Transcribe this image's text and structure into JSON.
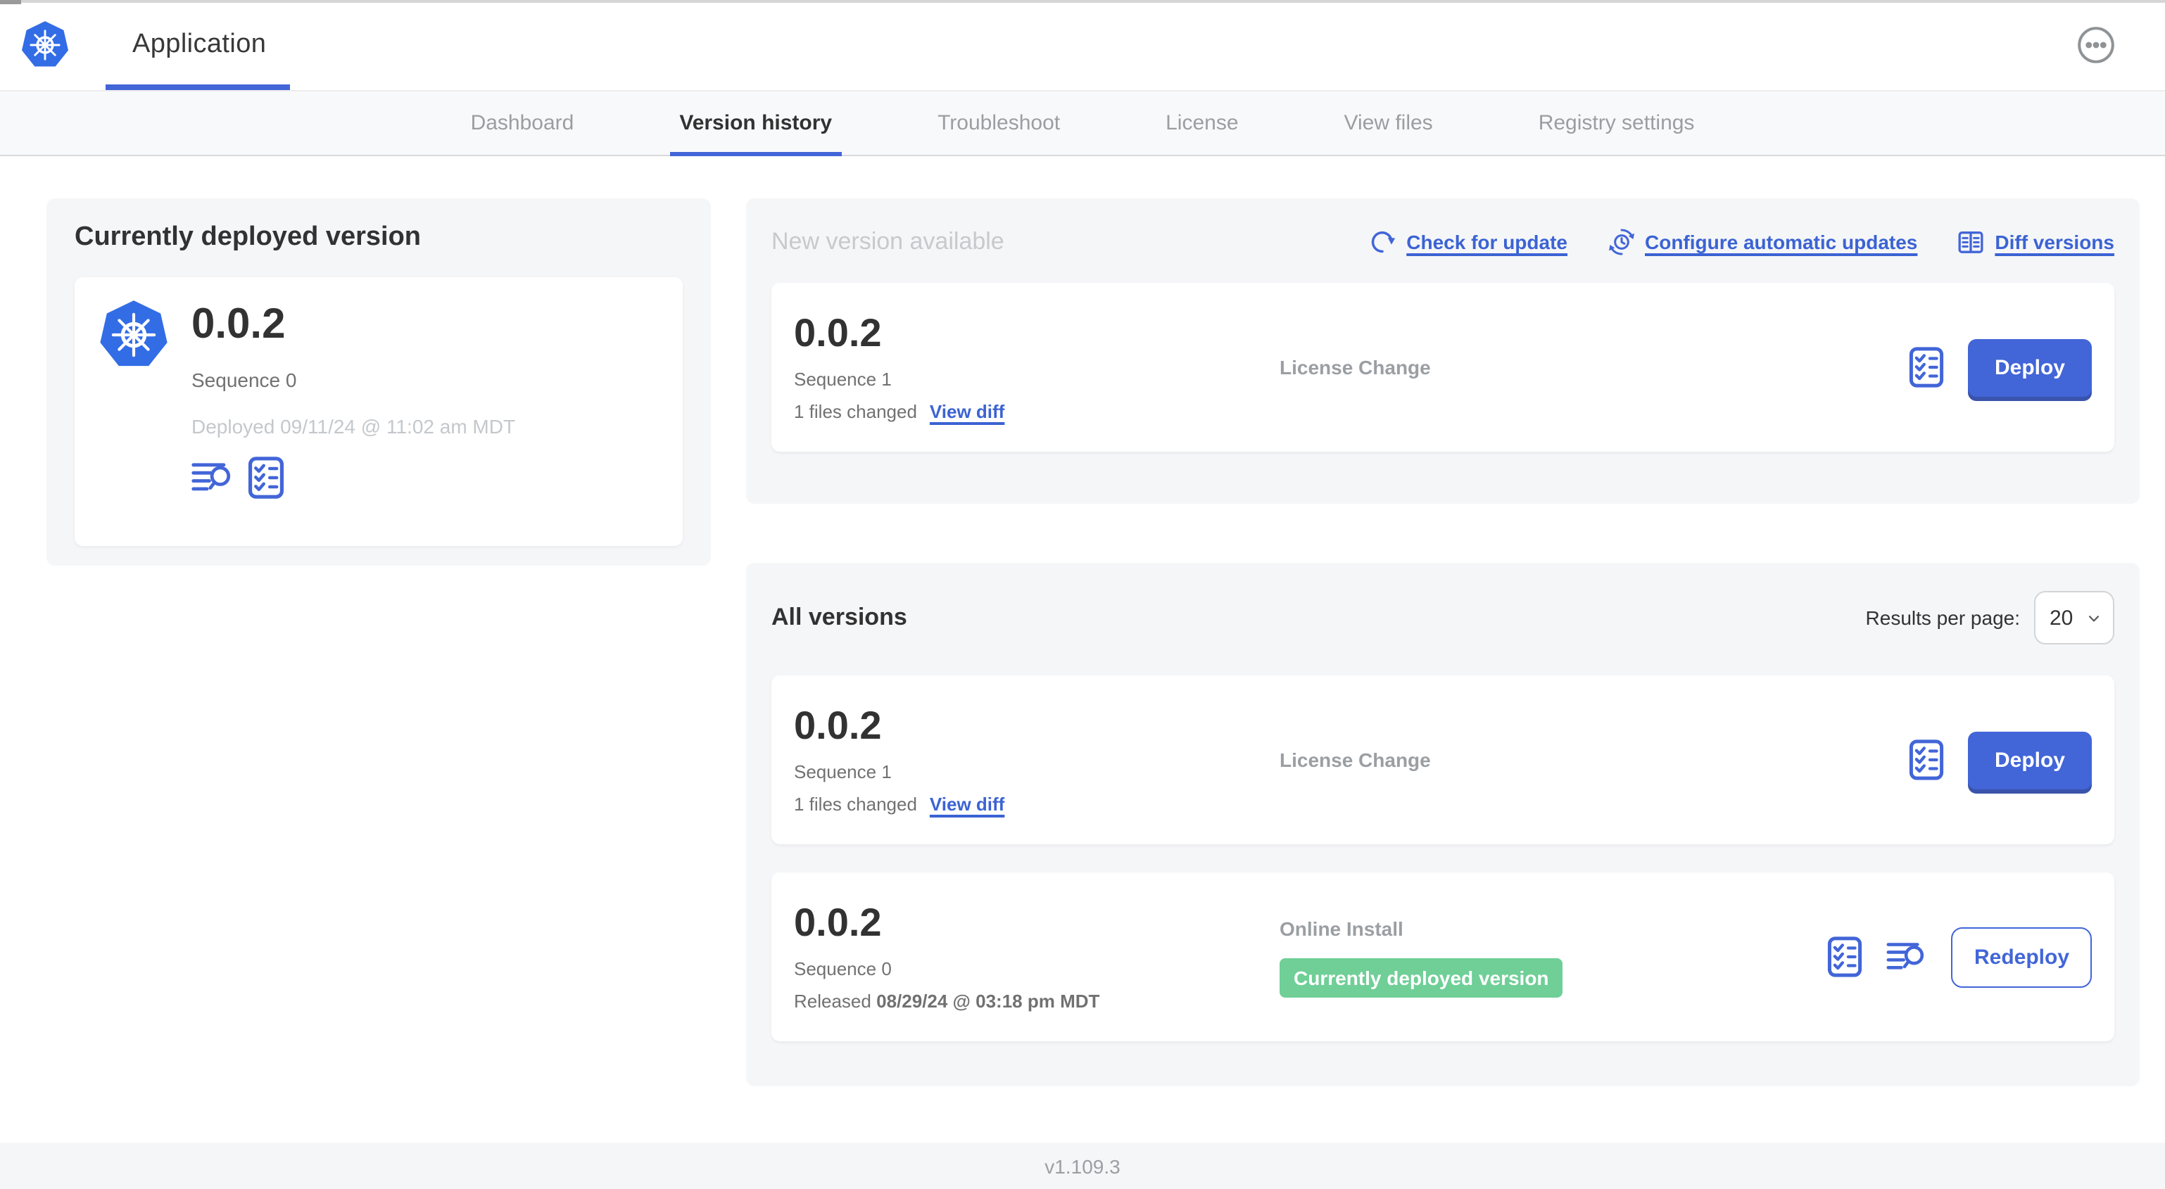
{
  "header": {
    "app_title": "Application"
  },
  "nav": {
    "tabs": [
      {
        "label": "Dashboard",
        "active": false
      },
      {
        "label": "Version history",
        "active": true
      },
      {
        "label": "Troubleshoot",
        "active": false
      },
      {
        "label": "License",
        "active": false
      },
      {
        "label": "View files",
        "active": false
      },
      {
        "label": "Registry settings",
        "active": false
      }
    ]
  },
  "current_version_card": {
    "title": "Currently deployed version",
    "version": "0.0.2",
    "sequence": "Sequence 0",
    "deployed": "Deployed 09/11/24 @ 11:02 am MDT"
  },
  "new_version_section": {
    "title": "New version available",
    "actions": {
      "check_for_update": "Check for update",
      "configure_automatic_updates": "Configure automatic updates",
      "diff_versions": "Diff versions"
    },
    "row": {
      "version": "0.0.2",
      "sequence": "Sequence 1",
      "files_changed": "1 files changed",
      "view_diff": "View diff",
      "source": "License Change",
      "deploy_label": "Deploy"
    }
  },
  "all_versions_section": {
    "title": "All versions",
    "results_per_page_label": "Results per page:",
    "results_per_page_value": "20",
    "rows": [
      {
        "version": "0.0.2",
        "sequence": "Sequence 1",
        "files_changed": "1 files changed",
        "view_diff": "View diff",
        "source": "License Change",
        "deploy_label": "Deploy"
      },
      {
        "version": "0.0.2",
        "sequence": "Sequence 0",
        "released_prefix": "Released",
        "released_date": "08/29/24 @ 03:18 pm MDT",
        "source": "Online Install",
        "badge": "Currently deployed version",
        "redeploy_label": "Redeploy"
      }
    ]
  },
  "footer": {
    "app_version": "v1.109.3"
  },
  "icons": {
    "kubernetes-logo-icon": "blue heptagon with white helm wheel",
    "ellipsis-icon": "three dots in circle",
    "refresh-icon": "circular arrow",
    "schedule-icon": "clock with circular update arrows",
    "diff-icon": "split panel with line rows",
    "checklist-icon": "boxed list with checkmarks",
    "logs-icon": "text lines with magnifier",
    "chevron-down-icon": "downward chevron"
  },
  "colors": {
    "accent_blue": "#4265d8",
    "k8s_blue": "#326de6",
    "badge_green": "#6fcf97",
    "section_gray": "#f5f6f8",
    "muted_text": "#9b9fa3",
    "dark_text": "#323232"
  }
}
